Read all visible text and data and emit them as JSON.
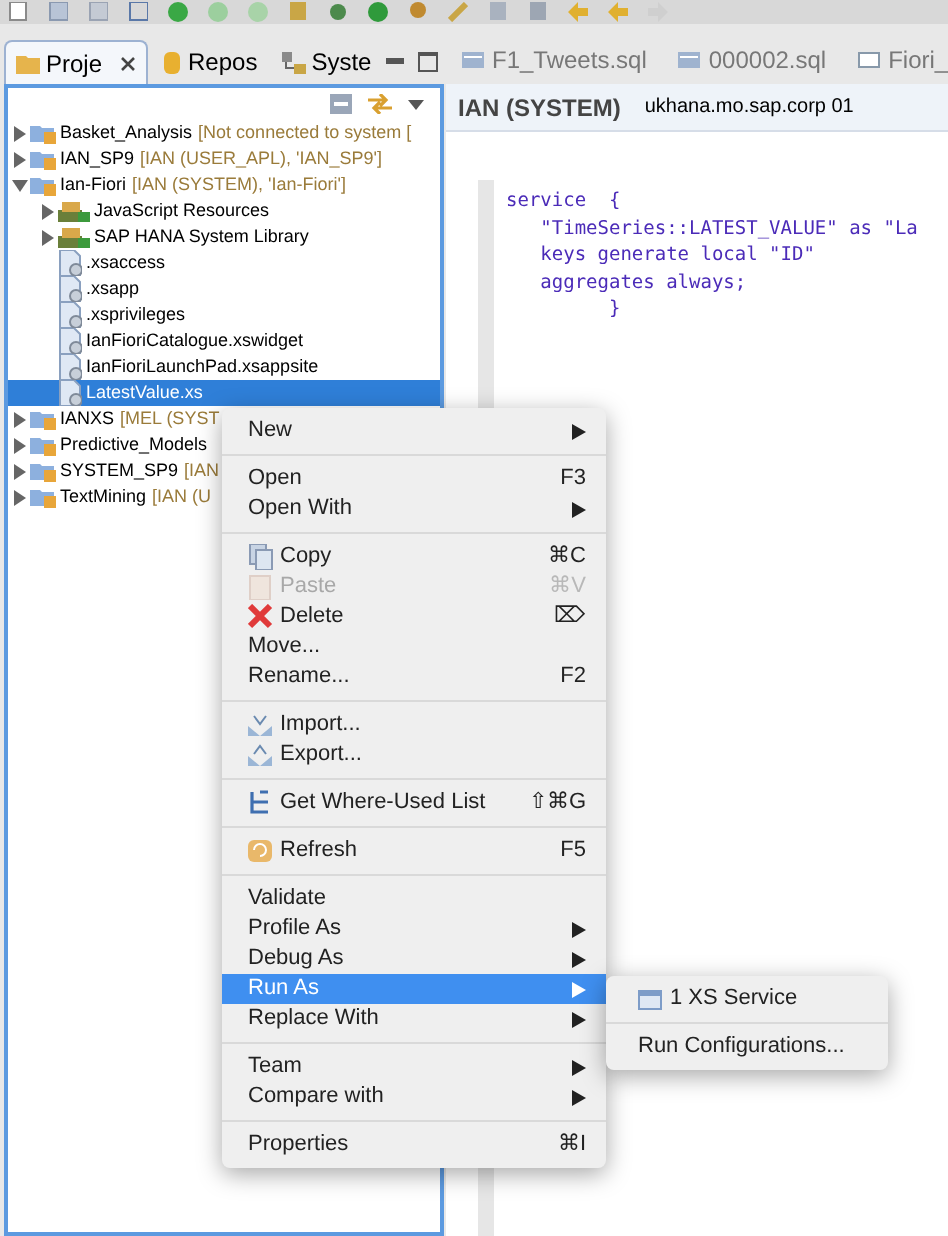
{
  "left_panel": {
    "tabs": [
      {
        "label": "Proje",
        "selected": true,
        "closable": true
      },
      {
        "label": "Repos",
        "selected": false,
        "closable": false
      },
      {
        "label": "Syste",
        "selected": false,
        "closable": false
      }
    ],
    "tree": [
      {
        "name": "Basket_Analysis",
        "decoration": "[Not connected to system [",
        "expanded": false,
        "selected": false
      },
      {
        "name": "IAN_SP9",
        "decoration": "[IAN (USER_APL), 'IAN_SP9']",
        "expanded": false,
        "selected": false
      },
      {
        "name": "Ian-Fiori",
        "decoration": "[IAN (SYSTEM), 'Ian-Fiori']",
        "expanded": true,
        "selected": false,
        "children": [
          {
            "name": "JavaScript Resources",
            "expanded": false,
            "selected": false
          },
          {
            "name": "SAP HANA System Library",
            "expanded": false,
            "selected": false
          },
          {
            "name": ".xsaccess",
            "selected": false
          },
          {
            "name": ".xsapp",
            "selected": false
          },
          {
            "name": ".xsprivileges",
            "selected": false
          },
          {
            "name": "IanFioriCatalogue.xswidget",
            "selected": false
          },
          {
            "name": "IanFioriLaunchPad.xsappsite",
            "selected": false
          },
          {
            "name": "LatestValue.xs",
            "selected": true
          }
        ]
      },
      {
        "name": "IANXS",
        "decoration": "[MEL (SYST",
        "expanded": false,
        "selected": false
      },
      {
        "name": "Predictive_Models",
        "expanded": false,
        "selected": false
      },
      {
        "name": "SYSTEM_SP9",
        "decoration": "[IAN",
        "expanded": false,
        "selected": false
      },
      {
        "name": "TextMining",
        "decoration": "[IAN (U",
        "expanded": false,
        "selected": false
      }
    ]
  },
  "editor": {
    "tabs": [
      {
        "label": "F1_Tweets.sql"
      },
      {
        "label": "000002.sql"
      },
      {
        "label": "Fiori_"
      }
    ],
    "connection": "IAN (SYSTEM)",
    "host": "ukhana.mo.sap.corp 01",
    "code": [
      "service  {",
      "   \"TimeSeries::LATEST_VALUE\" as \"La",
      "   keys generate local \"ID\"",
      "   aggregates always;",
      "         }"
    ]
  },
  "context_menu": {
    "groups": [
      [
        {
          "label": "New",
          "submenu": true
        }
      ],
      [
        {
          "label": "Open",
          "shortcut": "F3"
        },
        {
          "label": "Open With",
          "submenu": true
        }
      ],
      [
        {
          "label": "Copy",
          "shortcut": "⌘C"
        },
        {
          "label": "Paste",
          "shortcut": "⌘V",
          "disabled": true
        },
        {
          "label": "Delete",
          "shortcut": "⌦"
        },
        {
          "label": "Move..."
        },
        {
          "label": "Rename...",
          "shortcut": "F2"
        }
      ],
      [
        {
          "label": "Import..."
        },
        {
          "label": "Export..."
        }
      ],
      [
        {
          "label": "Get Where-Used List",
          "shortcut": "⇧⌘G"
        }
      ],
      [
        {
          "label": "Refresh",
          "shortcut": "F5"
        }
      ],
      [
        {
          "label": "Validate"
        },
        {
          "label": "Profile As",
          "submenu": true
        },
        {
          "label": "Debug As",
          "submenu": true
        },
        {
          "label": "Run As",
          "submenu": true,
          "selected": true
        },
        {
          "label": "Replace With",
          "submenu": true
        }
      ],
      [
        {
          "label": "Team",
          "submenu": true
        },
        {
          "label": "Compare with",
          "submenu": true
        }
      ],
      [
        {
          "label": "Properties",
          "shortcut": "⌘I"
        }
      ]
    ]
  },
  "submenu": {
    "groups": [
      [
        {
          "label": "1 XS Service"
        }
      ],
      [
        {
          "label": "Run Configurations..."
        }
      ]
    ]
  }
}
